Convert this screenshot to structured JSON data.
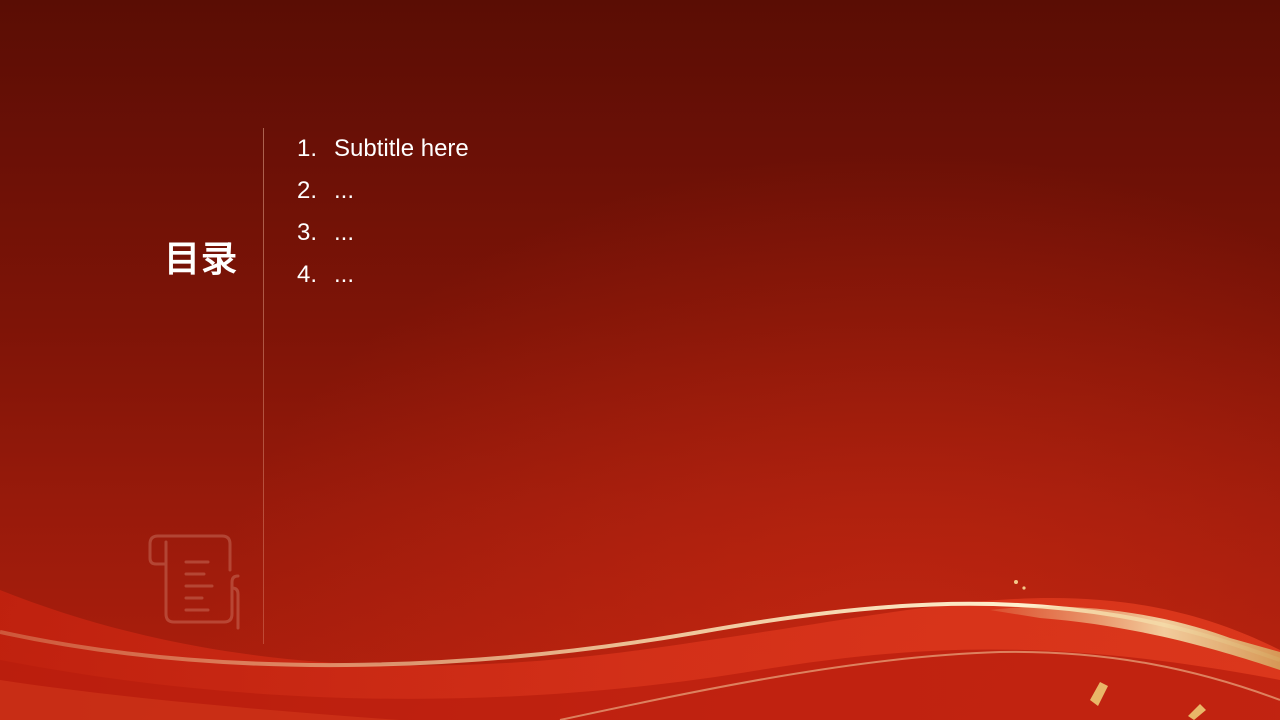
{
  "slide": {
    "title": "目录",
    "items": [
      {
        "number": "1.",
        "text": "Subtitle here"
      },
      {
        "number": "2.",
        "text": "..."
      },
      {
        "number": "3.",
        "text": "..."
      },
      {
        "number": "4.",
        "text": "..."
      }
    ],
    "icon": "scroll-document-icon",
    "colors": {
      "background_top": "#5a0d04",
      "background_bottom": "#b01f0d",
      "text": "#ffffff",
      "ribbon_gold": "#e8c07a"
    }
  }
}
